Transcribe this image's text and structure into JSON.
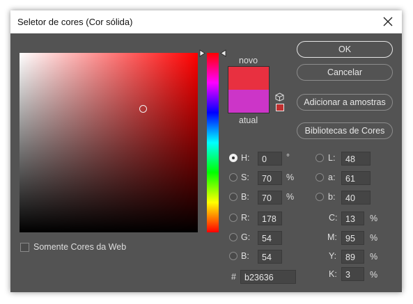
{
  "window": {
    "title": "Seletor de cores (Cor sólida)"
  },
  "colors": {
    "new": "#e83040",
    "current": "#cc35c8",
    "dialog_bg": "#535353"
  },
  "swatch": {
    "new_label": "novo",
    "current_label": "atual"
  },
  "buttons": {
    "ok": "OK",
    "cancel": "Cancelar",
    "add_to_swatches": "Adicionar a amostras",
    "color_libraries": "Bibliotecas de Cores"
  },
  "web_colors": {
    "label": "Somente Cores da Web",
    "checked": false
  },
  "hsb": [
    {
      "label": "H:",
      "value": "0",
      "unit": "°",
      "selected": true
    },
    {
      "label": "S:",
      "value": "70",
      "unit": "%",
      "selected": false
    },
    {
      "label": "B:",
      "value": "70",
      "unit": "%",
      "selected": false
    }
  ],
  "rgb": [
    {
      "label": "R:",
      "value": "178",
      "selected": false
    },
    {
      "label": "G:",
      "value": "54",
      "selected": false
    },
    {
      "label": "B:",
      "value": "54",
      "selected": false
    }
  ],
  "lab": [
    {
      "label": "L:",
      "value": "48",
      "selected": false
    },
    {
      "label": "a:",
      "value": "61",
      "selected": false
    },
    {
      "label": "b:",
      "value": "40",
      "selected": false
    }
  ],
  "cmyk": [
    {
      "label": "C:",
      "value": "13",
      "unit": "%"
    },
    {
      "label": "M:",
      "value": "95",
      "unit": "%"
    },
    {
      "label": "Y:",
      "value": "89",
      "unit": "%"
    },
    {
      "label": "K:",
      "value": "3",
      "unit": "%"
    }
  ],
  "hex": {
    "label": "#",
    "value": "b23636"
  },
  "icons": {
    "close": "close-icon",
    "cube": "web-safe-cube-icon",
    "gamut": "gamut-swatch-icon",
    "slider_arrows": "slider-arrow-icon",
    "picker": "color-picker-circle-icon"
  }
}
